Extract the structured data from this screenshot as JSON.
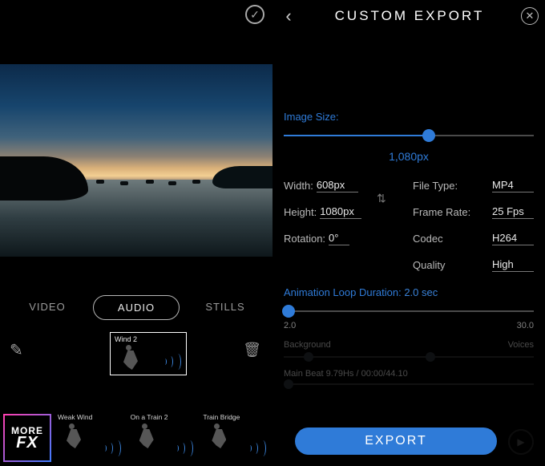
{
  "left": {
    "modes": {
      "video": "VIDEO",
      "audio": "AUDIO",
      "stills": "STILLS",
      "active": "audio"
    },
    "selected_preset": "Wind 2",
    "presets": [
      "Weak Wind",
      "On a Train 2",
      "Train Bridge"
    ],
    "morefx": {
      "line1": "MORE",
      "line2": "FX"
    }
  },
  "right": {
    "title": "CUSTOM  EXPORT",
    "image_size_label": "Image Size:",
    "image_size_value": "1,080px",
    "image_size_percent": 58,
    "width_label": "Width:",
    "width_value": "608px",
    "height_label": "Height:",
    "height_value": "1080px",
    "rotation_label": "Rotation:",
    "rotation_value": "0°",
    "filetype_label": "File Type:",
    "filetype_value": "MP4",
    "framerate_label": "Frame Rate:",
    "framerate_value": "25 Fps",
    "codec_label": "Codec",
    "codec_value": "H264",
    "quality_label": "Quality",
    "quality_value": "High",
    "anim_label": "Animation Loop Duration:",
    "anim_value": "2.0 sec",
    "anim_min": "2.0",
    "anim_max": "30.0",
    "ghost": {
      "bg": "Background",
      "voices": "Voices",
      "meta": "Main Beat 9.79Hs / 00:00/44.10"
    },
    "export": "EXPORT"
  }
}
